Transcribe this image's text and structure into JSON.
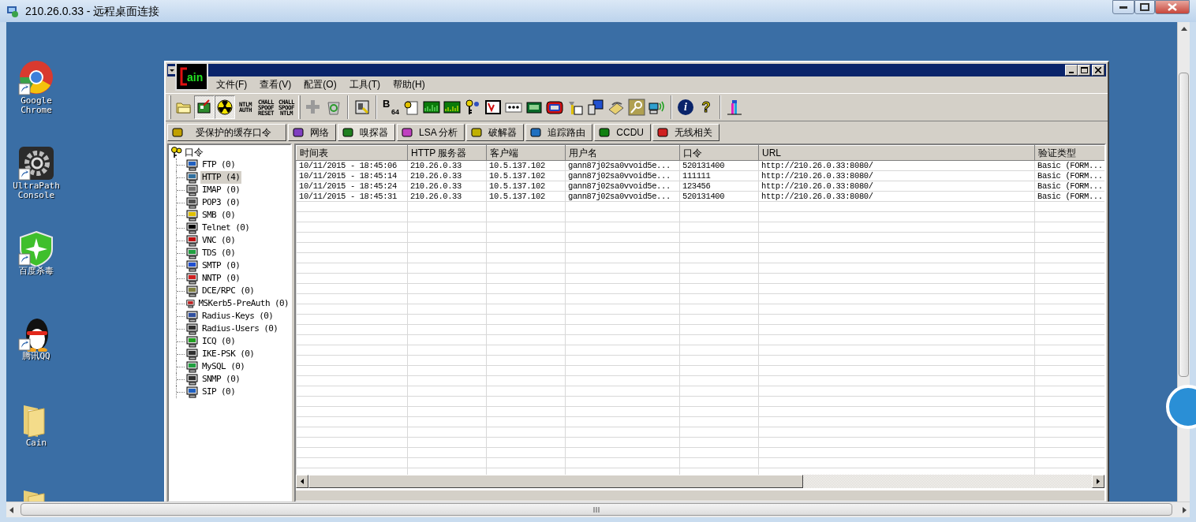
{
  "window": {
    "title": "210.26.0.33 - 远程桌面连接"
  },
  "desktop_icons": [
    {
      "label": [
        "Google",
        "Chrome"
      ]
    },
    {
      "label": [
        "UltraPath",
        "Console"
      ]
    },
    {
      "label": [
        "百度杀毒"
      ]
    },
    {
      "label": [
        "腾讯QQ"
      ]
    },
    {
      "label": [
        "Cain"
      ]
    }
  ],
  "cain": {
    "logo_text": "ain",
    "menu": [
      "文件(F)",
      "查看(V)",
      "配置(O)",
      "工具(T)",
      "帮助(H)"
    ],
    "toolbar": [
      [
        {
          "kind": "icon",
          "pressed": false
        },
        {
          "kind": "icon",
          "pressed": true
        },
        {
          "kind": "icon",
          "pressed": true
        },
        {
          "kind": "text",
          "label": [
            "NTLM",
            "AUTH"
          ],
          "pressed": false
        },
        {
          "kind": "text",
          "label": [
            "CHALL",
            "SPOOF",
            "RESET"
          ],
          "pressed": false
        },
        {
          "kind": "text",
          "label": [
            "CHALL",
            "SPOOF",
            "NTLM"
          ],
          "pressed": false
        }
      ],
      [
        {
          "kind": "icon",
          "pressed": false
        },
        {
          "kind": "icon",
          "pressed": false
        }
      ],
      [
        {
          "kind": "icon",
          "pressed": false
        }
      ],
      [
        {
          "kind": "b64",
          "label": [
            "B",
            "64"
          ],
          "pressed": false
        },
        {
          "kind": "icon",
          "pressed": false
        },
        {
          "kind": "icon",
          "pressed": false
        },
        {
          "kind": "icon",
          "pressed": false
        },
        {
          "kind": "icon",
          "pressed": false
        },
        {
          "kind": "icon",
          "pressed": false
        },
        {
          "kind": "icon",
          "pressed": false
        },
        {
          "kind": "icon",
          "pressed": false
        },
        {
          "kind": "icon",
          "pressed": false
        },
        {
          "kind": "icon",
          "pressed": false
        },
        {
          "kind": "icon",
          "pressed": false
        },
        {
          "kind": "icon",
          "pressed": false
        },
        {
          "kind": "icon",
          "pressed": false
        },
        {
          "kind": "icon",
          "pressed": false
        }
      ],
      [
        {
          "kind": "info",
          "label": "i",
          "pressed": false
        },
        {
          "kind": "glyph",
          "label": "?",
          "pressed": false
        }
      ],
      [
        {
          "kind": "icon",
          "pressed": false
        }
      ]
    ],
    "tabs": [
      {
        "label": "受保护的缓存口令",
        "selected": false
      },
      {
        "label": "网络",
        "selected": false
      },
      {
        "label": "嗅探器",
        "selected": true
      },
      {
        "label": "LSA 分析",
        "selected": false
      },
      {
        "label": "破解器",
        "selected": false
      },
      {
        "label": "追踪路由",
        "selected": false
      },
      {
        "label": "CCDU",
        "selected": false
      },
      {
        "label": "无线相关",
        "selected": false
      }
    ],
    "tree": {
      "label": "口令",
      "children": [
        {
          "label": "FTP (0)",
          "selected": false
        },
        {
          "label": "HTTP (4)",
          "selected": true
        },
        {
          "label": "IMAP (0)",
          "selected": false
        },
        {
          "label": "POP3 (0)",
          "selected": false
        },
        {
          "label": "SMB (0)",
          "selected": false
        },
        {
          "label": "Telnet (0)",
          "selected": false
        },
        {
          "label": "VNC (0)",
          "selected": false
        },
        {
          "label": "TDS (0)",
          "selected": false
        },
        {
          "label": "SMTP (0)",
          "selected": false
        },
        {
          "label": "NNTP (0)",
          "selected": false
        },
        {
          "label": "DCE/RPC (0)",
          "selected": false
        },
        {
          "label": "MSKerb5-PreAuth (0)",
          "selected": false
        },
        {
          "label": "Radius-Keys (0)",
          "selected": false
        },
        {
          "label": "Radius-Users (0)",
          "selected": false
        },
        {
          "label": "ICQ (0)",
          "selected": false
        },
        {
          "label": "IKE-PSK (0)",
          "selected": false
        },
        {
          "label": "MySQL (0)",
          "selected": false
        },
        {
          "label": "SNMP (0)",
          "selected": false
        },
        {
          "label": "SIP (0)",
          "selected": false
        }
      ]
    },
    "table": {
      "columns": [
        "时间表",
        "HTTP 服务器",
        "客户端",
        "用户名",
        "口令",
        "URL",
        "验证类型"
      ],
      "rows": [
        [
          "10/11/2015 - 18:45:06",
          "210.26.0.33",
          "10.5.137.102",
          "gann87j02sa0vvoid5e...",
          "520131400",
          "http://210.26.0.33:8080/",
          "Basic (FORM..."
        ],
        [
          "10/11/2015 - 18:45:14",
          "210.26.0.33",
          "10.5.137.102",
          "gann87j02sa0vvoid5e...",
          "111111",
          "http://210.26.0.33:8080/",
          "Basic (FORM..."
        ],
        [
          "10/11/2015 - 18:45:24",
          "210.26.0.33",
          "10.5.137.102",
          "gann87j02sa0vvoid5e...",
          "123456",
          "http://210.26.0.33:8080/",
          "Basic (FORM..."
        ],
        [
          "10/11/2015 - 18:45:31",
          "210.26.0.33",
          "10.5.137.102",
          "gann87j02sa0vvoid5e...",
          "520131400",
          "http://210.26.0.33:8080/",
          "Basic (FORM..."
        ]
      ]
    }
  }
}
